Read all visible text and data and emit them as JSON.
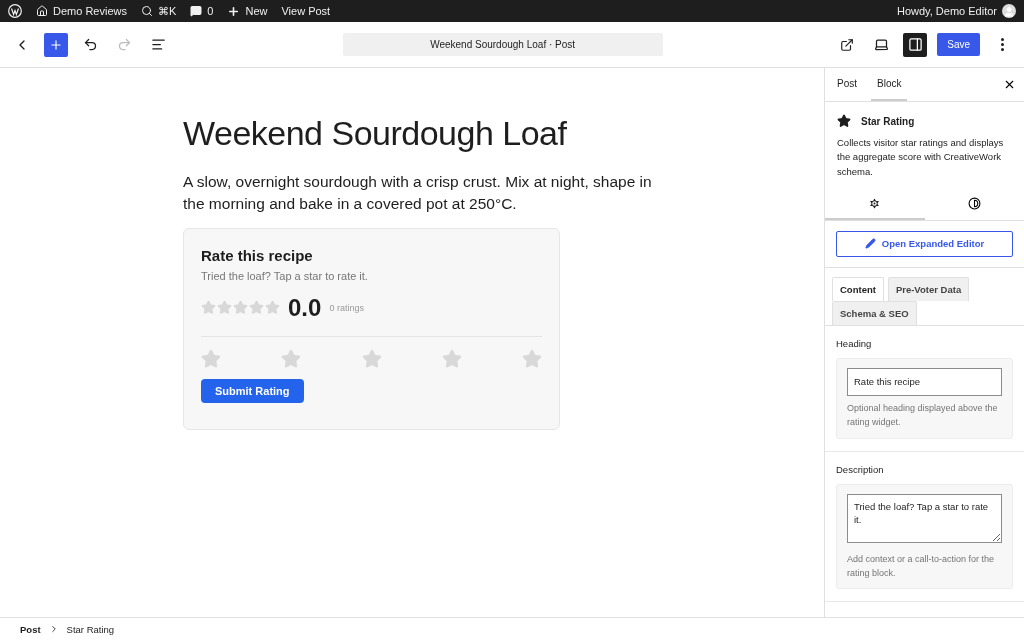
{
  "admin_bar": {
    "site": "Demo Reviews",
    "shortcut": "⌘K",
    "comments": "0",
    "new": "New",
    "view": "View Post",
    "greeting": "Howdy, Demo Editor"
  },
  "toolbar": {
    "document_title": "Weekend Sourdough Loaf · Post",
    "save": "Save",
    "sidebar_open": true
  },
  "post": {
    "title": "Weekend Sourdough Loaf",
    "excerpt": "A slow, overnight sourdough with a crisp crust. Mix at night, shape in the morning and bake in a covered pot at 250°C."
  },
  "rating_card": {
    "heading": "Rate this recipe",
    "description": "Tried the loaf? Tap a star to rate it.",
    "summary": {
      "stars": 0,
      "score": "0.0",
      "count": "0 ratings"
    },
    "star_input": {
      "stars": 0
    },
    "submit": "Submit Rating"
  },
  "sidebar": {
    "tabs": [
      {
        "label": "Post",
        "selected": false
      },
      {
        "label": "Block",
        "selected": true
      }
    ],
    "block": {
      "name": "Star Rating",
      "description": "Collects visitor star ratings and displays the aggregate score with CreativeWork schema."
    },
    "panel_tabs": [
      {
        "kind": "settings",
        "selected": true
      },
      {
        "kind": "styles",
        "selected": false
      }
    ],
    "expanded_editor": "Open Expanded Editor",
    "section_tabs": [
      {
        "label": "Content",
        "selected": true
      },
      {
        "label": "Pre-Voter Data",
        "selected": false
      },
      {
        "label": "Schema & SEO",
        "selected": false
      }
    ],
    "fields": [
      {
        "kind": "input",
        "label": "Heading",
        "value": "Rate this recipe",
        "help": "Optional heading displayed above the rating widget."
      },
      {
        "kind": "textarea",
        "label": "Description",
        "value": "Tried the loaf? Tap a star to rate it.",
        "help": "Add context or a call-to-action for the rating block."
      }
    ]
  },
  "breadcrumb": [
    "Post",
    "Star Rating"
  ]
}
